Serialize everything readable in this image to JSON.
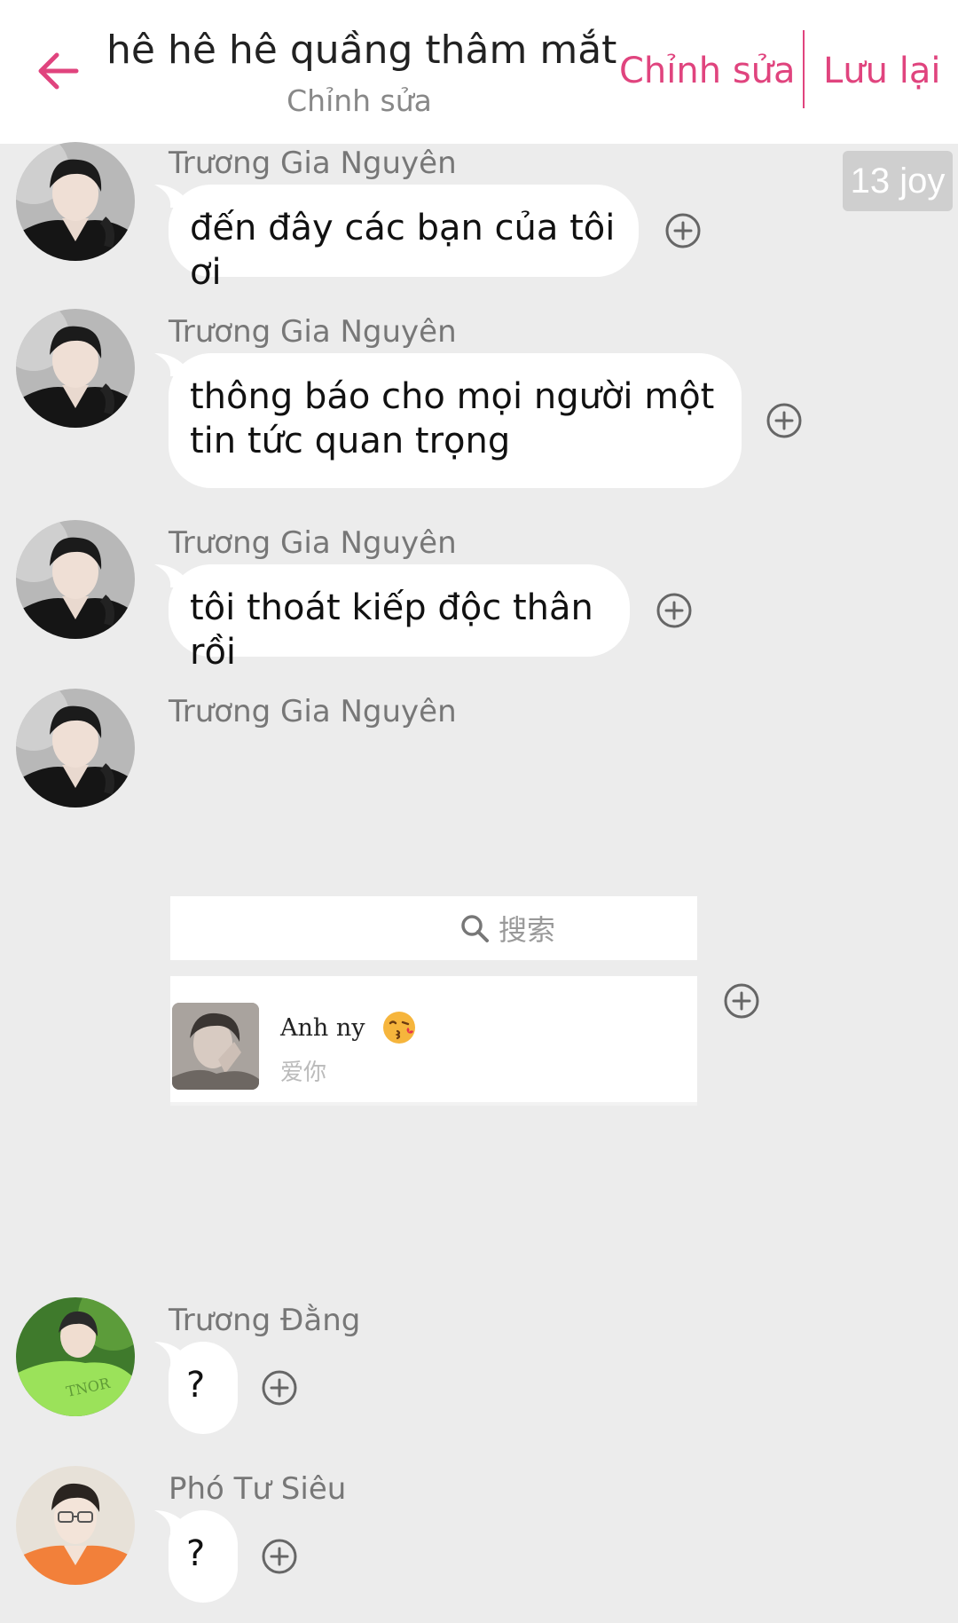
{
  "header": {
    "title": "hê hê hê quầng thâm mắt",
    "subtitle": "Chỉnh sửa",
    "edit_label": "Chỉnh sửa",
    "save_label": "Lưu lại",
    "accent_color": "#e0447e"
  },
  "time_badge": "13 joy",
  "messages": [
    {
      "sender": "Trương Gia Nguyên",
      "text": "đến đây các bạn của tôi ơi",
      "avatar": "avatar-black-shirt"
    },
    {
      "sender": "Trương Gia Nguyên",
      "text": "thông báo cho mọi người một tin tức quan trọng",
      "avatar": "avatar-black-shirt"
    },
    {
      "sender": "Trương Gia Nguyên",
      "text": "tôi thoát kiếp độc thân rồi",
      "avatar": "avatar-black-shirt"
    },
    {
      "sender": "Trương Gia Nguyên",
      "text": "",
      "avatar": "avatar-black-shirt",
      "shared_card": {
        "search_label": "搜索",
        "contact_name": "Anh ny",
        "contact_emoji": "😘",
        "contact_message": "爱你"
      }
    },
    {
      "sender": "Trương Đằng",
      "text": "?",
      "avatar": "avatar-green-shirt"
    },
    {
      "sender": "Phó Tư Siêu",
      "text": "?",
      "avatar": "avatar-orange-shirt"
    }
  ],
  "icons": {
    "back": "arrow-left-icon",
    "add": "plus-circle-icon",
    "search": "search-icon"
  }
}
